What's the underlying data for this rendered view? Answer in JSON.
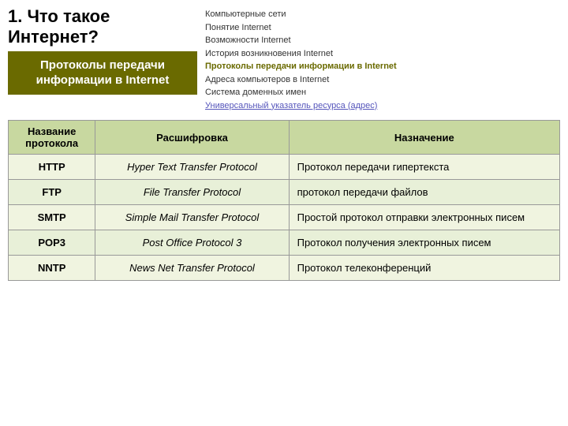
{
  "header": {
    "title": "1. Что такое Интернет?",
    "subtitle": "Протоколы передачи информации в  Internet",
    "nav": [
      {
        "label": "Компьютерные сети",
        "type": "normal"
      },
      {
        "label": "Понятие Internet",
        "type": "normal"
      },
      {
        "label": "Возможности Internet",
        "type": "normal"
      },
      {
        "label": "История возникновения Internet",
        "type": "normal"
      },
      {
        "label": "Протоколы передачи информации в Internet",
        "type": "highlight"
      },
      {
        "label": "Адреса компьютеров в Internet",
        "type": "normal"
      },
      {
        "label": "Система доменных имен",
        "type": "normal"
      },
      {
        "label": "Универсальный указатель ресурса (адрес)",
        "type": "link"
      }
    ]
  },
  "table": {
    "headers": [
      "Название протокола",
      "Расшифровка",
      "Назначение"
    ],
    "rows": [
      {
        "name": "HTTP",
        "decode": "Hyper Text Transfer Protocol",
        "purpose": "Протокол передачи гипертекста"
      },
      {
        "name": "FTP",
        "decode": "File Transfer Protocol",
        "purpose": "протокол передачи файлов"
      },
      {
        "name": "SMTP",
        "decode": "Simple Mail Transfer Protocol",
        "purpose": "Простой протокол отправки электронных писем"
      },
      {
        "name": "POP3",
        "decode": "Post Office Protocol 3",
        "purpose": "Протокол получения электронных писем"
      },
      {
        "name": "NNTP",
        "decode": "News Net Transfer Protocol",
        "purpose": "Протокол телеконференций"
      }
    ]
  }
}
